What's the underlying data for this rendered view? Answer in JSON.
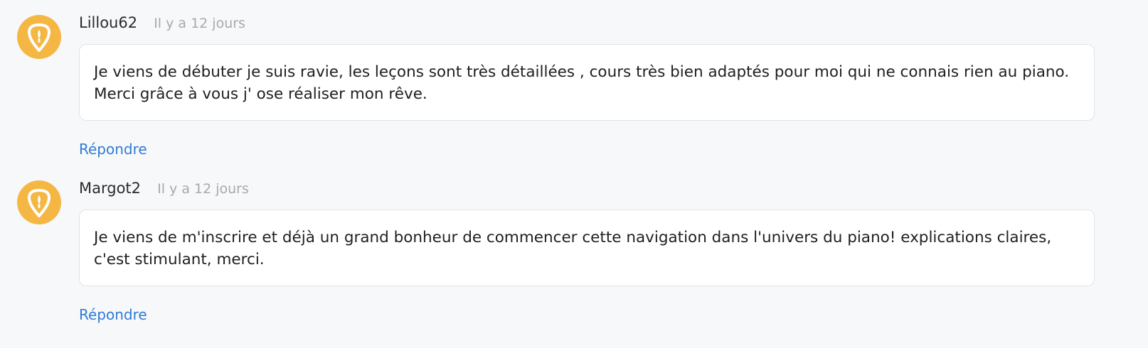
{
  "colors": {
    "avatar": "#f5b744",
    "link": "#2f7bd6",
    "background": "#f7f8f9"
  },
  "comments": [
    {
      "author": "Lillou62",
      "time": "Il y a 12 jours",
      "avatar_icon": "guitar-pick-logo-icon",
      "text": "Je viens de débuter je suis ravie, les leçons sont très détaillées , cours très bien adaptés pour moi qui ne connais rien au piano. Merci grâce à vous j' ose réaliser mon rêve.",
      "reply_label": "Répondre"
    },
    {
      "author": "Margot2",
      "time": "Il y a 12 jours",
      "avatar_icon": "guitar-pick-logo-icon",
      "text": "Je viens de m'inscrire et déjà un grand bonheur de commencer cette navigation dans l'univers du piano! explications claires, c'est stimulant, merci.",
      "reply_label": "Répondre"
    }
  ]
}
